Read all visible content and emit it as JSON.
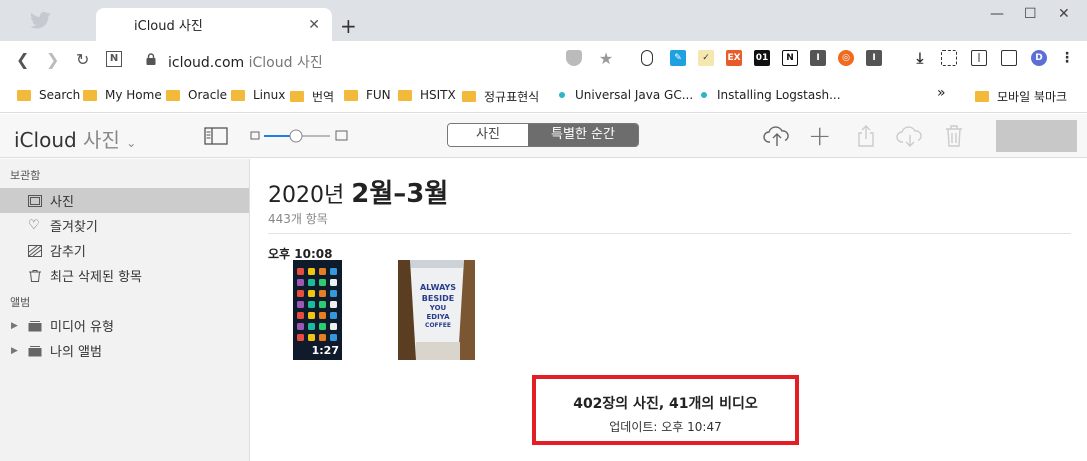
{
  "browser": {
    "tab_title": "iCloud 사진",
    "url_domain": "icloud.com",
    "url_title": "iCloud 사진",
    "extensions": [
      "shield-icon",
      "star-icon",
      "mouse-icon",
      "pen-icon",
      "chart-icon",
      "ex-icon",
      "01-icon",
      "notion-icon",
      "i-icon",
      "lifebuoy-icon",
      "i-icon-2",
      "download-icon",
      "capture-icon",
      "reader-icon",
      "sidebar-icon",
      "profile-d",
      "menu-icon"
    ],
    "ext_labels": {
      "ex": "EX",
      "o1": "01",
      "n": "N",
      "i": "I",
      "profile": "D"
    },
    "bookmarks": [
      {
        "label": "Search",
        "type": "folder"
      },
      {
        "label": "My Home",
        "type": "folder"
      },
      {
        "label": "Oracle",
        "type": "folder"
      },
      {
        "label": "Linux",
        "type": "folder"
      },
      {
        "label": "번역",
        "type": "folder"
      },
      {
        "label": "FUN",
        "type": "folder"
      },
      {
        "label": "HSITX",
        "type": "folder"
      },
      {
        "label": "정규표현식",
        "type": "folder"
      },
      {
        "label": "Universal Java GC...",
        "type": "link"
      },
      {
        "label": "Installing Logstash...",
        "type": "link"
      }
    ],
    "overflow": "»",
    "mobile_bookmarks": "모바일 북마크"
  },
  "app": {
    "brand": "iCloud",
    "brand_sub": "사진",
    "segments": [
      "사진",
      "특별한 순간"
    ],
    "active_segment": "특별한 순간"
  },
  "sidebar": {
    "section_library": "보관함",
    "library_items": [
      "사진",
      "즐겨찾기",
      "감추기",
      "최근 삭제된 항목"
    ],
    "selected": "사진",
    "section_albums": "앨범",
    "album_items": [
      "미디어 유형",
      "나의 앨범"
    ]
  },
  "main": {
    "year": "2020년",
    "range": "2월–3월",
    "count": "443개 항목",
    "time": "오후 10:08",
    "video_duration": "1:27",
    "cup_text": "ALWAYS BESIDE YOU EDIYA COFFEE",
    "summary_line1": "402장의 사진, 41개의 비디오",
    "summary_line2": "업데이트: 오후 10:47"
  },
  "colors": {
    "accent_red": "#e31e25",
    "selected_bg": "#cccccc",
    "folder": "#f2b93b",
    "segment_active": "#6d6d6d"
  }
}
